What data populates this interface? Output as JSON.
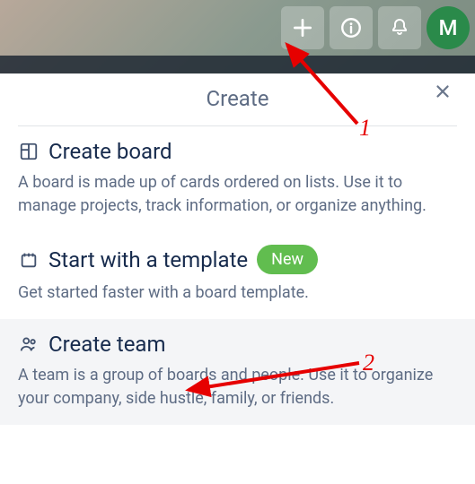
{
  "header": {
    "avatar_letter": "M"
  },
  "popup": {
    "title": "Create",
    "options": [
      {
        "title": "Create board",
        "desc": "A board is made up of cards ordered on lists. Use it to manage projects, track information, or organize anything."
      },
      {
        "title": "Start with a template",
        "badge": "New",
        "desc": "Get started faster with a board template."
      },
      {
        "title": "Create team",
        "desc": "A team is a group of boards and people. Use it to organize your company, side hustle, family, or friends."
      }
    ]
  },
  "annotations": {
    "label1": "1",
    "label2": "2"
  }
}
